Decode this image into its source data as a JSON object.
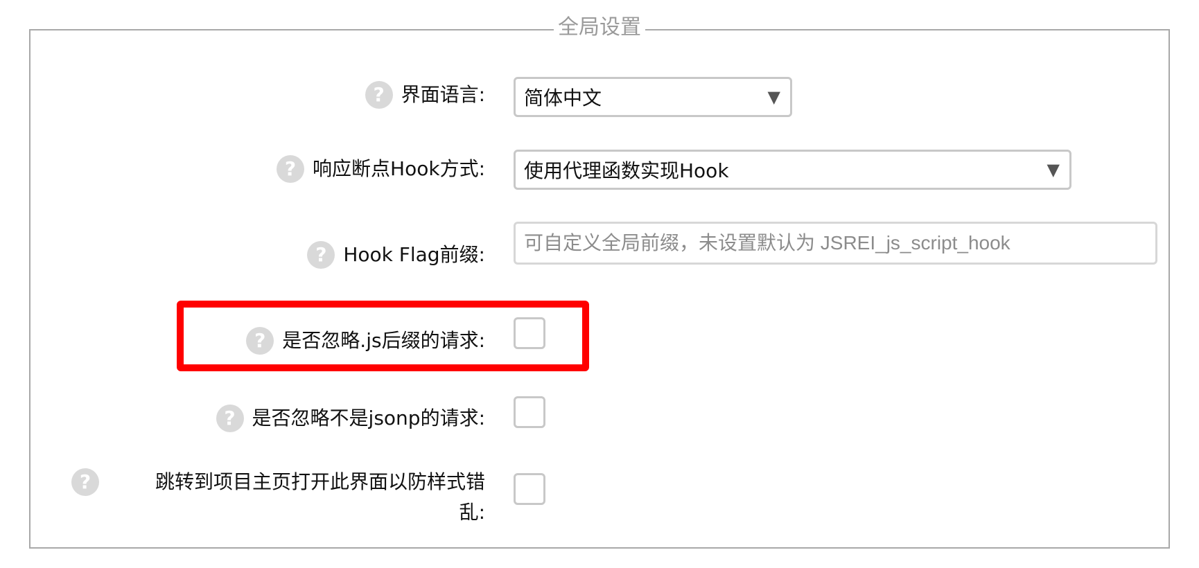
{
  "section": {
    "title": "全局设置"
  },
  "fields": {
    "language": {
      "label": "界面语言:",
      "value": "简体中文"
    },
    "hook_method": {
      "label": "响应断点Hook方式:",
      "value": "使用代理函数实现Hook"
    },
    "hook_flag": {
      "label": "Hook Flag前缀:",
      "placeholder": "可自定义全局前缀，未设置默认为 JSREI_js_script_hook",
      "value": ""
    },
    "ignore_js": {
      "label": "是否忽略.js后缀的请求:",
      "checked": false
    },
    "ignore_non_jsonp": {
      "label": "是否忽略不是jsonp的请求:",
      "checked": false
    },
    "jump_to_project": {
      "label_line1": "跳转到项目主页打开此界面以防样式错",
      "label_line2": "乱:",
      "checked": false
    }
  },
  "icons": {
    "help": "?",
    "dropdown": "▼"
  },
  "colors": {
    "highlight": "#ff0000",
    "border": "#a8a8a8",
    "help_icon_bg": "#d9d9d9"
  }
}
